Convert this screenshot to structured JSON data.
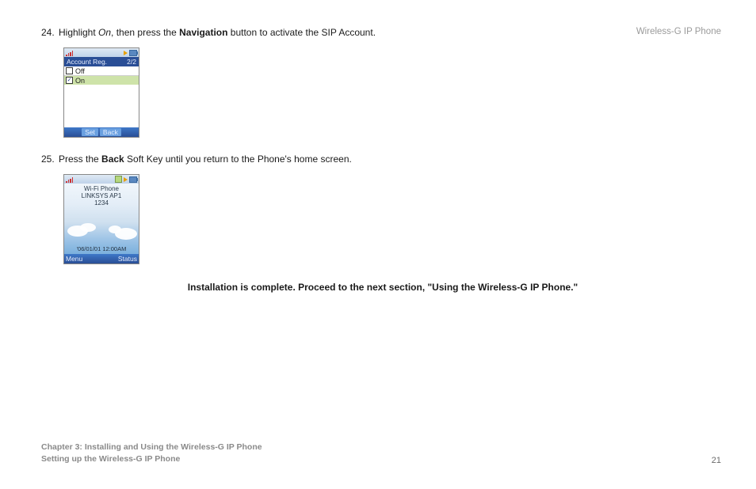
{
  "header": {
    "title": "Wireless-G IP Phone"
  },
  "steps": {
    "s24": {
      "num": "24.",
      "t1": "Highlight ",
      "em": "On",
      "t2": ", then press the ",
      "b1": "Navigation",
      "t3": " button to activate the SIP Account."
    },
    "s25": {
      "num": "25.",
      "t1": "Press the ",
      "b1": "Back",
      "t2": " Soft Key until you return to the Phone's home screen."
    }
  },
  "phone1": {
    "title": "Account Reg.",
    "counter": "2/2",
    "off": "Off",
    "on": "On",
    "soft_set": "Set",
    "soft_back": "Back"
  },
  "phone2": {
    "line1": "Wi-Fi Phone",
    "line2": "LINKSYS AP1",
    "line3": "1234",
    "timestamp": "'06/01/01  12:00AM",
    "soft_left": "Menu",
    "soft_right": "Status"
  },
  "completion": "Installation is complete. Proceed to the next section, \"Using the Wireless-G IP Phone.\"",
  "footer": {
    "chapter": "Chapter 3: Installing and Using the Wireless-G IP Phone",
    "section": "Setting up the Wireless-G IP Phone",
    "page": "21"
  }
}
